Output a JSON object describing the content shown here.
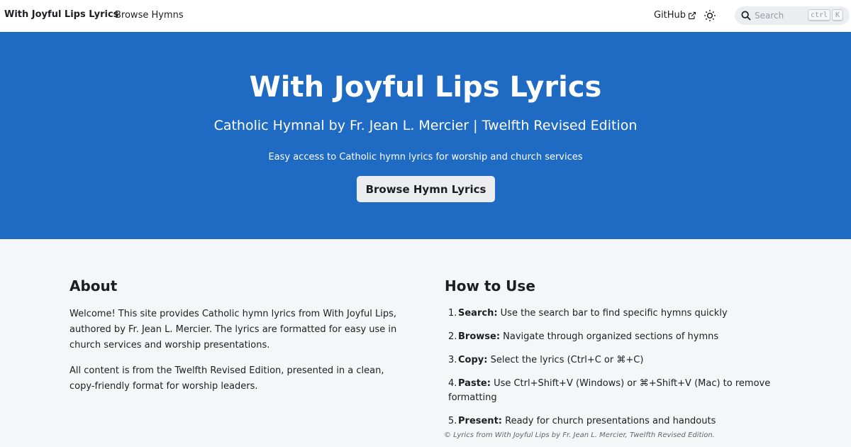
{
  "navbar": {
    "brand": "With Joyful Lips Lyrics",
    "links": [
      "Browse Hymns"
    ],
    "github_label": "GitHub",
    "search_placeholder": "Search",
    "kbd_ctrl": "ctrl",
    "kbd_k": "K"
  },
  "hero": {
    "title": "With Joyful Lips Lyrics",
    "subtitle": "Catholic Hymnal by Fr. Jean L. Mercier | Twelfth Revised Edition",
    "tagline": "Easy access to Catholic hymn lyrics for worship and church services",
    "button_label": "Browse Hymn Lyrics",
    "background_color": "#1f6ac2"
  },
  "about": {
    "heading": "About",
    "paragraphs": [
      "Welcome! This site provides Catholic hymn lyrics from With Joyful Lips, authored by Fr. Jean L. Mercier. The lyrics are formatted for easy use in church services and worship presentations.",
      "All content is from the Twelfth Revised Edition, presented in a clean, copy-friendly format for worship leaders."
    ]
  },
  "howto": {
    "heading": "How to Use",
    "steps": [
      {
        "num": "1.",
        "label": "Search:",
        "text": "Use the search bar to find specific hymns quickly"
      },
      {
        "num": "2.",
        "label": "Browse:",
        "text": "Navigate through organized sections of hymns"
      },
      {
        "num": "3.",
        "label": "Copy:",
        "text": "Select the lyrics (Ctrl+C or ⌘+C)"
      },
      {
        "num": "4.",
        "label": "Paste:",
        "text": "Use Ctrl+Shift+V (Windows) or ⌘+Shift+V (Mac) to remove formatting"
      },
      {
        "num": "5.",
        "label": "Present:",
        "text": "Ready for church presentations and handouts"
      }
    ],
    "footer_note": "© Lyrics from With Joyful Lips by Fr. Jean L. Mercier, Twelfth Revised Edition."
  },
  "icons": {
    "external_link": "external-link-icon",
    "theme": "sun-icon",
    "search": "search-icon"
  }
}
